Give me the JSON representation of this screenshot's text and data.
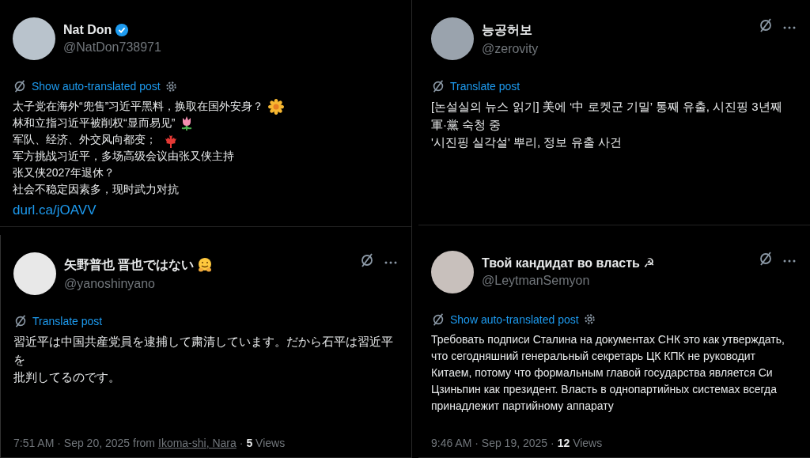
{
  "columns": [
    {
      "posts": [
        {
          "name": "Nat Don",
          "verified": true,
          "handle": "@NatDon738971",
          "actions": false,
          "translate": {
            "label": "Show auto-translated post",
            "settings": true
          },
          "lines": [
            {
              "text": "太子党在海外“兜售”习近平黑料，换取在国外安身？",
              "kind": "flower"
            },
            {
              "text": "林和立指习近平被削权“显而易见”",
              "kind": "tulip"
            },
            {
              "text": "军队、经济、外交风向都变；",
              "kind": "maple"
            },
            {
              "text": "军方挑战习近平，多场高级会议由张又侠主持",
              "kind": "plain"
            },
            {
              "text": "张又侠2027年退休？",
              "kind": "plain"
            },
            {
              "text": "社会不稳定因素多，现时武力对抗",
              "kind": "plain"
            }
          ],
          "link": "durl.ca/jOAVV"
        },
        {
          "name": "矢野普也 晋也ではない",
          "name_badge": {
            "kind": "hug"
          },
          "handle": "@yanoshinyano",
          "actions": true,
          "translate": {
            "label": "Translate post"
          },
          "lines": [
            {
              "text": "習近平は中国共産党員を逮捕して粛清しています。だから石平は習近平を",
              "kind": "plain"
            },
            {
              "text": "批判してるのです。",
              "kind": "plain"
            }
          ],
          "meta": {
            "posted": "7:51 AM · Sep 20, 2025 from",
            "place": "Ikoma-shi, Nara",
            "views": "· **5** Views"
          }
        }
      ]
    },
    {
      "posts": [
        {
          "name": "능공허보",
          "handle": "@zerovity",
          "actions": true,
          "translate": {
            "label": "Translate post"
          },
          "lines": [
            {
              "text": "[논설실의 뉴스 읽기] 美에 ‘中 로켓군 기밀’ 통째 유출, 시진핑 3년째 軍·黨 숙청 중",
              "kind": "plain"
            },
            {
              "text": "'시진핑 실각설' 뿌리, 정보 유출 사건",
              "kind": "plain"
            }
          ]
        },
        {
          "name": "Твой кандидат во власть ☭",
          "handle": "@LeytmanSemyon",
          "actions": true,
          "translate": {
            "label": "Show auto-translated post",
            "settings": true
          },
          "lines": [
            {
              "text": "Требовать подписи Сталина на документах СНК это как утверждать,",
              "kind": "plain"
            },
            {
              "text": "что сегодняшний генеральный секретарь ЦК КПК не руководит",
              "kind": "plain"
            },
            {
              "text": "Китаем, потому что формальным главой государства является Си",
              "kind": "plain"
            },
            {
              "text": "Цзиньпин как президент. Власть в однопартийных системах всегда",
              "kind": "plain"
            },
            {
              "text": "принадлежит партийному аппарату",
              "kind": "plain"
            }
          ],
          "meta": {
            "posted": "9:46 AM · Sep 19, 2025",
            "views": "· **12** Views"
          }
        }
      ]
    }
  ]
}
